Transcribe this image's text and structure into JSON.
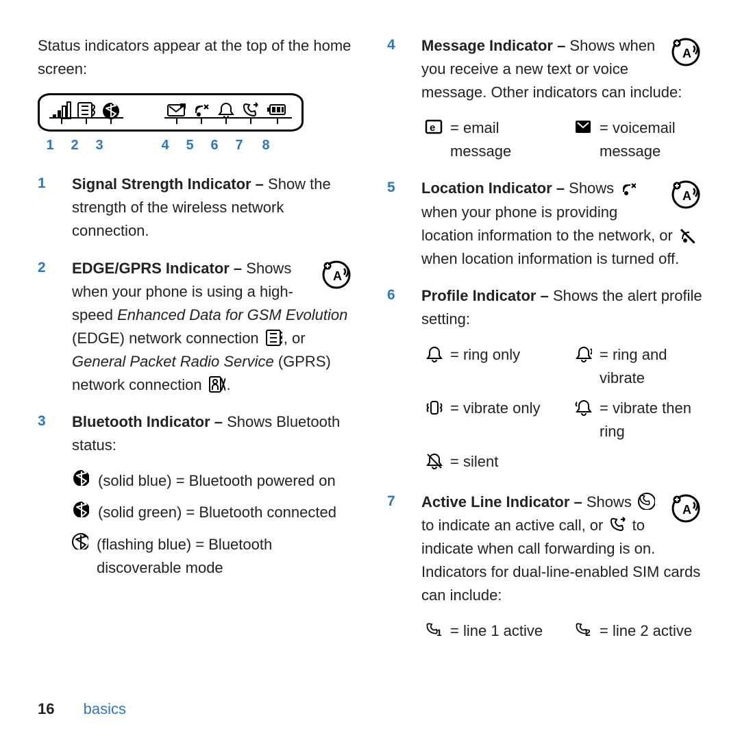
{
  "intro": "Status indicators appear at the top of the home screen:",
  "diagram_numbers": [
    "1",
    "2",
    "3",
    "4",
    "5",
    "6",
    "7",
    "8"
  ],
  "items": {
    "i1": {
      "num": "1",
      "title": "Signal Strength Indicator –",
      "textA": " Show the strength of the wireless network connection."
    },
    "i2": {
      "num": "2",
      "title": "EDGE/GPRS Indicator –",
      "lead": " Shows when your phone is using a high-speed ",
      "em1": "Enhanced Data for GSM Evolution",
      "mid1": " (EDGE) network connection ",
      "mid2": ", or ",
      "em2": "General Packet Radio Service",
      "tail": " (GPRS) network connection ",
      "dot": "."
    },
    "i3": {
      "num": "3",
      "title": "Bluetooth Indicator –",
      "text": " Shows Bluetooth status:",
      "r1": " (solid blue) = Bluetooth powered on",
      "r2": " (solid green) = Bluetooth connected",
      "r3": " (flashing blue) = Bluetooth discoverable mode"
    },
    "i4": {
      "num": "4",
      "title": "Message Indicator –",
      "text": " Shows when you receive a new text or voice message. Other indicators can include:",
      "c1": " = email message",
      "c2": " = voicemail message"
    },
    "i5": {
      "num": "5",
      "title": "Location Indicator –",
      "a": " Shows ",
      "b": " when your phone is providing location information to the network, or ",
      "c": " when location information is turned off."
    },
    "i6": {
      "num": "6",
      "title": "Profile Indicator –",
      "text": " Shows the alert profile setting:",
      "p1": " = ring only",
      "p2": " = ring and vibrate",
      "p3": " = vibrate only",
      "p4": " = vibrate then ring",
      "p5": " = silent"
    },
    "i7": {
      "num": "7",
      "title": "Active Line Indicator –",
      "a": " Shows ",
      "b": " to indicate an active call, or ",
      "c": " to indicate when call forwarding is on. Indicators for dual-line-enabled SIM cards can include:",
      "c1": " = line 1 active",
      "c2": " = line 2 active"
    }
  },
  "footer": {
    "page": "16",
    "section": "basics"
  }
}
